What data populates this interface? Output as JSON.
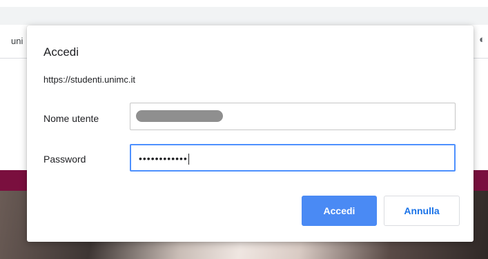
{
  "background": {
    "nav_text": "uni",
    "globe_icon": "globe-icon",
    "banner_color": "#7a0f3e"
  },
  "dialog": {
    "title": "Accedi",
    "origin": "https://studenti.unimc.it",
    "username": {
      "label": "Nome utente",
      "value_obscured": true
    },
    "password": {
      "label": "Password",
      "value": "••••••••••••",
      "focused": true
    },
    "buttons": {
      "primary": "Accedi",
      "cancel": "Annulla"
    },
    "colors": {
      "primary_button": "#4a8af4",
      "focus_border": "#4d90fe",
      "cancel_text": "#1a73e8"
    }
  }
}
